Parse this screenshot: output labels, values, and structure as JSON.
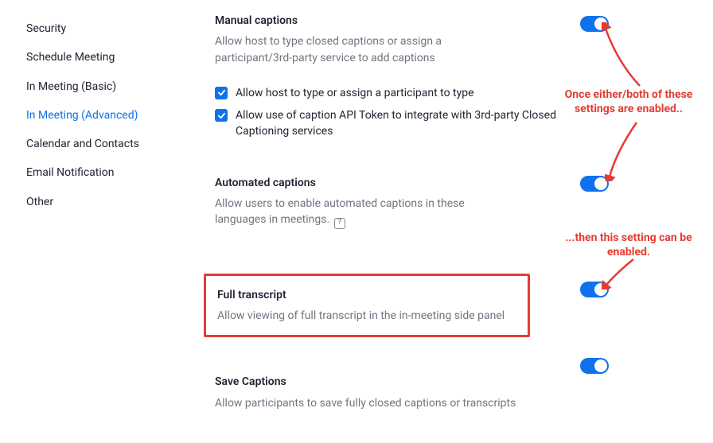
{
  "sidebar": {
    "items": [
      {
        "label": "Security",
        "active": false
      },
      {
        "label": "Schedule Meeting",
        "active": false
      },
      {
        "label": "In Meeting (Basic)",
        "active": false
      },
      {
        "label": "In Meeting (Advanced)",
        "active": true
      },
      {
        "label": "Calendar and Contacts",
        "active": false
      },
      {
        "label": "Email Notification",
        "active": false
      },
      {
        "label": "Other",
        "active": false
      }
    ]
  },
  "settings": {
    "manual_captions": {
      "title": "Manual captions",
      "desc": "Allow host to type closed captions or assign a participant/3rd-party service to add captions",
      "checks": [
        {
          "label": "Allow host to type or assign a participant to type",
          "checked": true
        },
        {
          "label": "Allow use of caption API Token to integrate with 3rd-party Closed Captioning services",
          "checked": true
        }
      ],
      "toggle_on": true
    },
    "automated_captions": {
      "title": "Automated captions",
      "desc": "Allow users to enable automated captions in these languages in meetings.",
      "toggle_on": true
    },
    "full_transcript": {
      "title": "Full transcript",
      "desc": "Allow viewing of full transcript in the in-meeting side panel",
      "toggle_on": true
    },
    "save_captions": {
      "title": "Save Captions",
      "desc": "Allow participants to save fully closed captions or transcripts",
      "toggle_on": true
    }
  },
  "annotations": {
    "a1": "Once either/both of these settings are enabled..",
    "a2": "...then this setting can be enabled."
  }
}
